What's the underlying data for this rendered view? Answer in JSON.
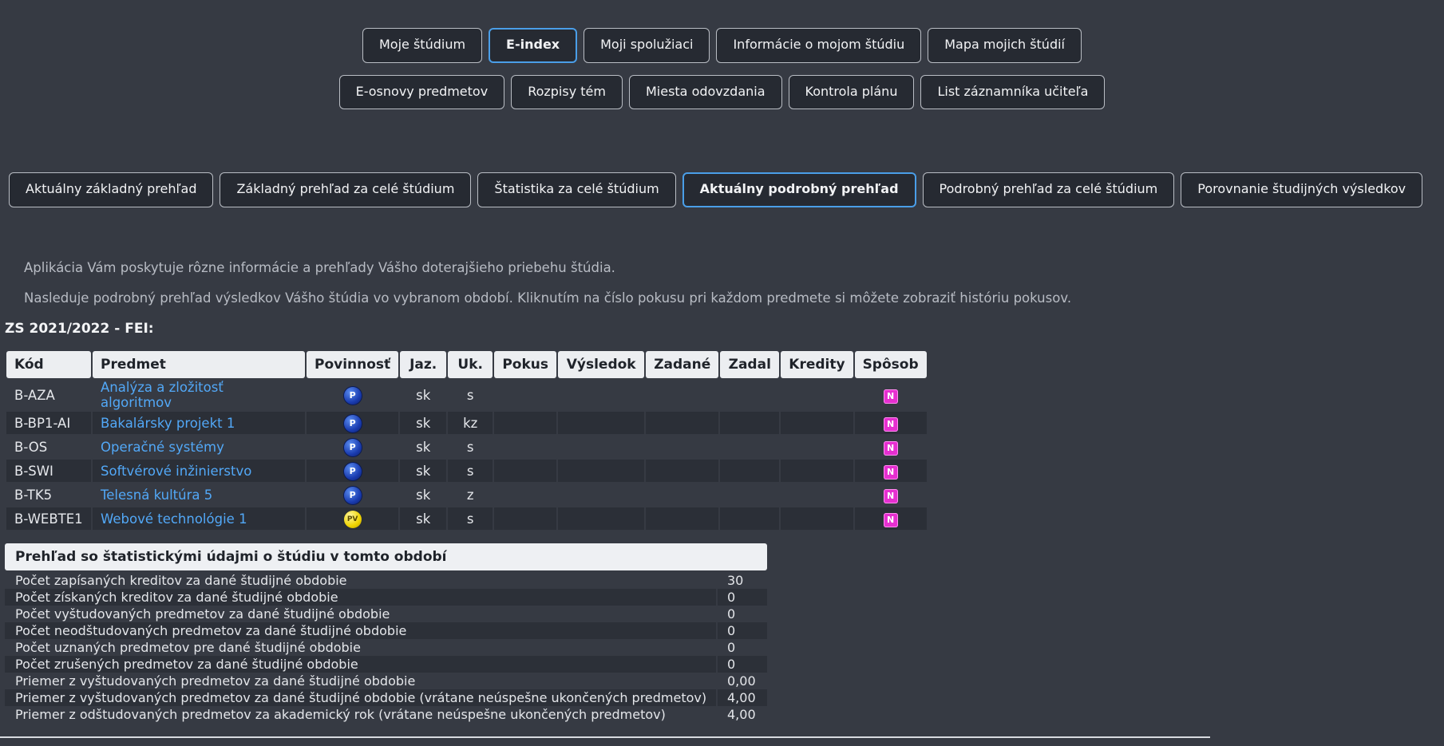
{
  "nav_primary": [
    {
      "label": "Moje štúdium",
      "active": false
    },
    {
      "label": "E-index",
      "active": true
    },
    {
      "label": "Moji spolužiaci",
      "active": false
    },
    {
      "label": "Informácie o mojom štúdiu",
      "active": false
    },
    {
      "label": "Mapa mojich štúdií",
      "active": false
    }
  ],
  "nav_secondary": [
    {
      "label": "E-osnovy predmetov"
    },
    {
      "label": "Rozpisy tém"
    },
    {
      "label": "Miesta odovzdania"
    },
    {
      "label": "Kontrola plánu"
    },
    {
      "label": "List záznamníka učiteľa"
    }
  ],
  "tabs": [
    {
      "label": "Aktuálny základný prehľad",
      "active": false
    },
    {
      "label": "Základný prehľad za celé štúdium",
      "active": false
    },
    {
      "label": "Štatistika za celé štúdium",
      "active": false
    },
    {
      "label": "Aktuálny podrobný prehľad",
      "active": true
    },
    {
      "label": "Podrobný prehľad za celé štúdium",
      "active": false
    },
    {
      "label": "Porovnanie študijných výsledkov",
      "active": false
    }
  ],
  "info": {
    "line1": "Aplikácia Vám poskytuje rôzne informácie a prehľady Vášho doterajšieho priebehu štúdia.",
    "line2": "Nasleduje podrobný prehľad výsledkov Vášho štúdia vo vybranom období. Kliknutím na číslo pokusu pri každom predmete si môžete zobraziť históriu pokusov."
  },
  "period": "ZS 2021/2022 - FEI:",
  "table": {
    "headers": [
      "Kód",
      "Predmet",
      "Povinnosť",
      "Jaz.",
      "Uk.",
      "Pokus",
      "Výsledok",
      "Zadané",
      "Zadal",
      "Kredity",
      "Spôsob"
    ],
    "rows": [
      {
        "code": "B-AZA",
        "name": "Analýza a zložitosť algoritmov",
        "duty": "P",
        "lang": "sk",
        "uk": "s",
        "mode": "N"
      },
      {
        "code": "B-BP1-AI",
        "name": "Bakalársky projekt 1",
        "duty": "P",
        "lang": "sk",
        "uk": "kz",
        "mode": "N"
      },
      {
        "code": "B-OS",
        "name": "Operačné systémy",
        "duty": "P",
        "lang": "sk",
        "uk": "s",
        "mode": "N"
      },
      {
        "code": "B-SWI",
        "name": "Softvérové inžinierstvo",
        "duty": "P",
        "lang": "sk",
        "uk": "s",
        "mode": "N"
      },
      {
        "code": "B-TK5",
        "name": "Telesná kultúra 5",
        "duty": "P",
        "lang": "sk",
        "uk": "z",
        "mode": "N"
      },
      {
        "code": "B-WEBTE1",
        "name": "Webové technológie 1",
        "duty": "PV",
        "lang": "sk",
        "uk": "s",
        "mode": "N"
      }
    ]
  },
  "stats": {
    "title": "Prehľad so štatistickými údajmi o štúdiu v tomto období",
    "rows": [
      {
        "label": "Počet zapísaných kreditov za dané študijné obdobie",
        "value": "30"
      },
      {
        "label": "Počet získaných kreditov za dané študijné obdobie",
        "value": "0"
      },
      {
        "label": "Počet vyštudovaných predmetov za dané študijné obdobie",
        "value": "0"
      },
      {
        "label": "Počet neodštudovaných predmetov za dané študijné obdobie",
        "value": "0"
      },
      {
        "label": "Počet uznaných predmetov pre dané študijné obdobie",
        "value": "0"
      },
      {
        "label": "Počet zrušených predmetov za dané študijné obdobie",
        "value": "0"
      },
      {
        "label": "Priemer z vyštudovaných predmetov za dané študijné obdobie",
        "value": "0,00"
      },
      {
        "label": "Priemer z vyštudovaných predmetov za dané študijné obdobie (vrátane neúspešne ukončených predmetov)",
        "value": "4,00"
      },
      {
        "label": "Priemer z odštudovaných predmetov za akademický rok (vrátane neúspešne ukončených predmetov)",
        "value": "4,00"
      }
    ]
  }
}
